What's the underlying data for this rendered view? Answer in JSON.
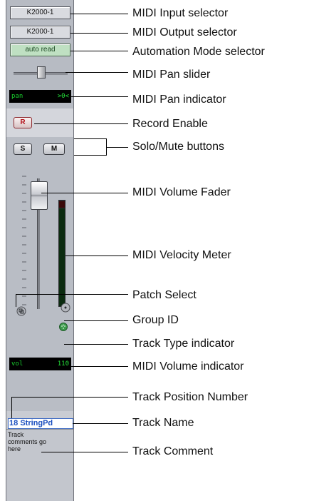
{
  "strip": {
    "midi_input": "K2000-1",
    "midi_output": "K2000-1",
    "automation_mode": "auto read",
    "pan_display": {
      "label": "pan",
      "value": ">0<"
    },
    "record_label": "R",
    "solo_label": "S",
    "mute_label": "M",
    "volume_display": {
      "label": "vol",
      "value": "110"
    },
    "track_number": "18",
    "track_name": "StringPd",
    "track_comment": "Track\ncomments go\nhere"
  },
  "callouts": [
    {
      "label": "MIDI Input selector"
    },
    {
      "label": "MIDI Output selector"
    },
    {
      "label": "Automation Mode selector"
    },
    {
      "label": "MIDI Pan slider"
    },
    {
      "label": "MIDI Pan indicator"
    },
    {
      "label": "Record Enable"
    },
    {
      "label": "Solo/Mute buttons"
    },
    {
      "label": "MIDI Volume Fader"
    },
    {
      "label": "MIDI Velocity Meter"
    },
    {
      "label": "Patch Select"
    },
    {
      "label": "Group ID"
    },
    {
      "label": "Track Type indicator"
    },
    {
      "label": "MIDI Volume indicator"
    },
    {
      "label": "Track Position Number"
    },
    {
      "label": "Track Name"
    },
    {
      "label": "Track Comment"
    }
  ]
}
